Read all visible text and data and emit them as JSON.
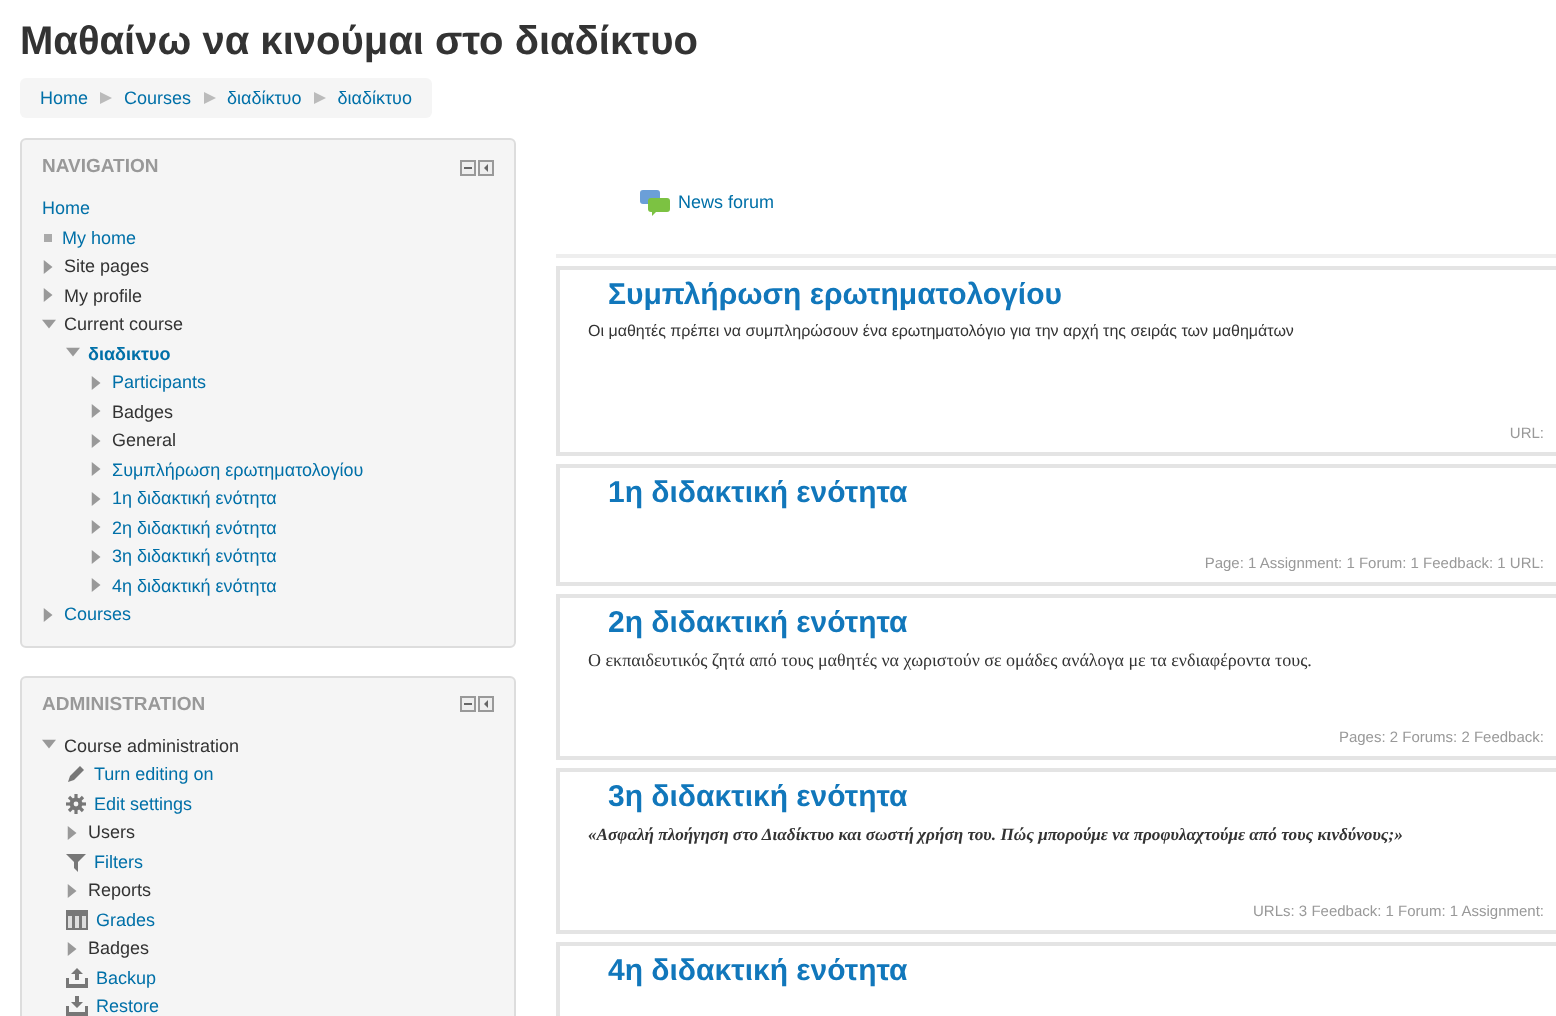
{
  "page_title": "Μαθαίνω να κινούμαι στο διαδίκτυο",
  "breadcrumb": [
    "Home",
    "Courses",
    "διαδίκτυο",
    "διαδίκτυο"
  ],
  "navigation": {
    "title": "NAVIGATION",
    "home": "Home",
    "items": [
      {
        "label": "My home",
        "kind": "leaf",
        "link": true,
        "selected": false
      },
      {
        "label": "Site pages",
        "kind": "branch",
        "link": false,
        "expanded": false,
        "selected": false
      },
      {
        "label": "My profile",
        "kind": "branch",
        "link": false,
        "expanded": false,
        "selected": false
      },
      {
        "label": "Current course",
        "kind": "branch",
        "link": false,
        "expanded": true,
        "selected": false,
        "children": [
          {
            "label": "διαδικτυο",
            "kind": "branch",
            "link": true,
            "expanded": true,
            "selected": true,
            "children": [
              {
                "label": "Participants",
                "kind": "branch",
                "link": true,
                "expanded": false,
                "selected": false
              },
              {
                "label": "Badges",
                "kind": "branch",
                "link": false,
                "expanded": false,
                "selected": false
              },
              {
                "label": "General",
                "kind": "branch",
                "link": false,
                "expanded": false,
                "selected": false
              },
              {
                "label": "Συμπλήρωση ερωτηματολογίου",
                "kind": "branch",
                "link": true,
                "expanded": false,
                "selected": false
              },
              {
                "label": "1η διδακτική ενότητα",
                "kind": "branch",
                "link": true,
                "expanded": false,
                "selected": false
              },
              {
                "label": "2η διδακτική ενότητα",
                "kind": "branch",
                "link": true,
                "expanded": false,
                "selected": false
              },
              {
                "label": "3η διδακτική ενότητα",
                "kind": "branch",
                "link": true,
                "expanded": false,
                "selected": false
              },
              {
                "label": "4η διδακτική ενότητα",
                "kind": "branch",
                "link": true,
                "expanded": false,
                "selected": false
              }
            ]
          }
        ]
      },
      {
        "label": "Courses",
        "kind": "branch",
        "link": true,
        "expanded": false,
        "selected": false
      }
    ]
  },
  "administration": {
    "title": "ADMINISTRATION",
    "items": [
      {
        "label": "Course administration",
        "kind": "branch",
        "link": false,
        "expanded": true,
        "children": [
          {
            "label": "Turn editing on",
            "kind": "edit",
            "link": true
          },
          {
            "label": "Edit settings",
            "kind": "settings",
            "link": true
          },
          {
            "label": "Users",
            "kind": "branch",
            "link": false,
            "expanded": false
          },
          {
            "label": "Filters",
            "kind": "filter",
            "link": true
          },
          {
            "label": "Reports",
            "kind": "branch",
            "link": false,
            "expanded": false
          },
          {
            "label": "Grades",
            "kind": "grades",
            "link": true
          },
          {
            "label": "Badges",
            "kind": "branch",
            "link": false,
            "expanded": false
          },
          {
            "label": "Backup",
            "kind": "backup",
            "link": true
          },
          {
            "label": "Restore",
            "kind": "restore",
            "link": true
          }
        ]
      }
    ]
  },
  "news_forum": "News forum",
  "sections": [
    {
      "title": "Συμπλήρωση ερωτηματολογίου",
      "summary": "Οι μαθητές πρέπει να συμπληρώσουν ένα ερωτηματολόγιο για την αρχή της σειράς των μαθημάτων",
      "kind": "sans",
      "activities": "URL:"
    },
    {
      "title": "1η διδακτική ενότητα",
      "activities": "Page: 1  Assignment: 1  Forum: 1  Feedback: 1  URL:"
    },
    {
      "title": "2η διδακτική ενότητα",
      "summary": "Ο εκπαιδευτικός ζητά από τους μαθητές να χωριστούν σε ομάδες ανάλογα με τα ενδιαφέροντα τους.",
      "kind": "serif",
      "activities": "Pages: 2  Forums: 2  Feedback:"
    },
    {
      "title": "3η διδακτική ενότητα",
      "summary": "«Ασφαλή πλοήγηση στο Διαδίκτυο και σωστή χρήση του. Πώς μπορούμε να προφυλαχτούμε από τους κινδύνους;»",
      "kind": "quote",
      "activities": "URLs: 3  Feedback: 1  Forum: 1  Assignment:"
    },
    {
      "title": "4η διδακτική ενότητα"
    }
  ]
}
